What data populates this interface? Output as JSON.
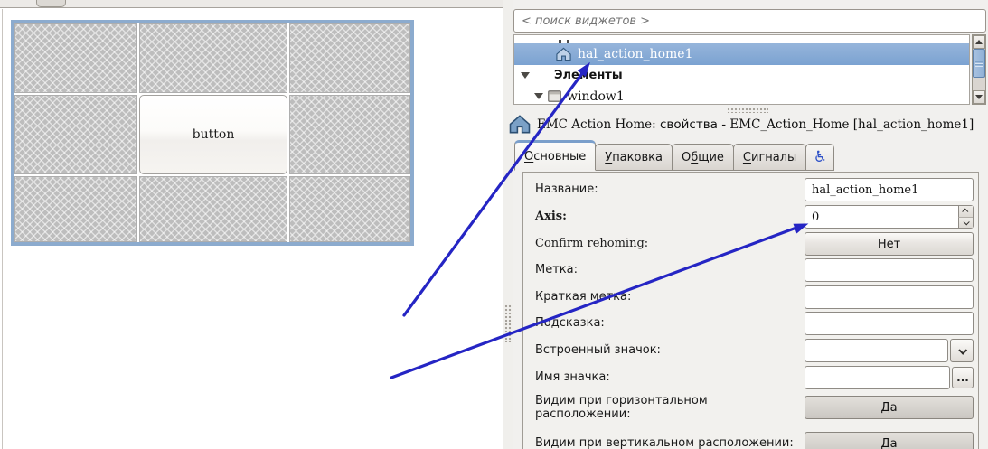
{
  "workspace": {
    "button_label": "button"
  },
  "search": {
    "placeholder": "< поиск виджетов >"
  },
  "tree": {
    "selected_item": "hal_action_home1",
    "section_label": "Элементы",
    "child_label": "window1"
  },
  "header": {
    "p1": "EMC Action Home: ",
    "p2": "свойства",
    "p3": " - ",
    "p4": "EMC_Action_Home [hal_action_home1]"
  },
  "tabs": {
    "general": {
      "pre": "",
      "key": "О",
      "post": "сновные"
    },
    "packing": {
      "pre": "",
      "key": "У",
      "post": "паковка"
    },
    "common": {
      "pre": "О",
      "key": "б",
      "post": "щие"
    },
    "signals": {
      "pre": "",
      "key": "С",
      "post": "игналы"
    },
    "accessibility_icon": "♿"
  },
  "props": {
    "name": {
      "label": "Название:",
      "value": "hal_action_home1"
    },
    "axis": {
      "label": "Axis:",
      "value": "0"
    },
    "confirm": {
      "label": "Confirm rehoming:",
      "value": "Нет"
    },
    "label_row": {
      "label": "Метка:",
      "value": ""
    },
    "short_label": {
      "label": "Краткая метка:",
      "value": ""
    },
    "tooltip": {
      "label": "Подсказка:",
      "value": ""
    },
    "stock_icon": {
      "label": "Встроенный значок:",
      "value": ""
    },
    "icon_name": {
      "label": "Имя значка:",
      "value": "",
      "button": "..."
    },
    "vis_h": {
      "label": "Видим при горизонтальном расположении:",
      "value": "Да"
    },
    "vis_v": {
      "label": "Видим при вертикальном расположении:",
      "value": "Да"
    }
  },
  "colors": {
    "arrow": "#2525c4",
    "selection_top": "#96b5db",
    "selection_bottom": "#7ba2d1",
    "canvas_selection_border": "#8cabce"
  }
}
